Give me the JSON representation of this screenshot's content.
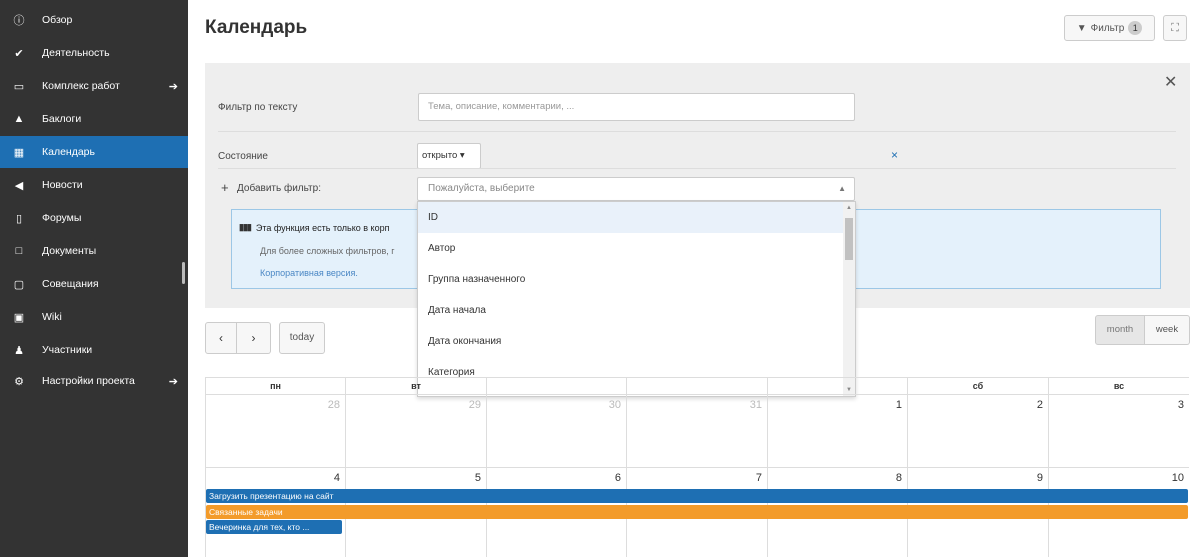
{
  "sidebar": {
    "items": [
      {
        "icon": "info-icon",
        "glyph": "ⓘ",
        "label": "Обзор"
      },
      {
        "icon": "check-icon",
        "glyph": "✔",
        "label": "Деятельность"
      },
      {
        "icon": "folder-icon",
        "glyph": "▭",
        "label": "Комплекс работ",
        "arrow": "➔"
      },
      {
        "icon": "warning-icon",
        "glyph": "▲",
        "label": "Баклоги"
      },
      {
        "icon": "calendar-icon",
        "glyph": "▦",
        "label": "Календарь"
      },
      {
        "icon": "megaphone-icon",
        "glyph": "◀",
        "label": "Новости"
      },
      {
        "icon": "forum-icon",
        "glyph": "▯",
        "label": "Форумы"
      },
      {
        "icon": "document-icon",
        "glyph": "□",
        "label": "Документы"
      },
      {
        "icon": "meeting-icon",
        "glyph": "▢",
        "label": "Совещания"
      },
      {
        "icon": "book-icon",
        "glyph": "▣",
        "label": "Wiki"
      },
      {
        "icon": "users-icon",
        "glyph": "♟",
        "label": "Участники"
      },
      {
        "icon": "settings-icon",
        "glyph": "⚙",
        "label": "Настройки проекта",
        "arrow": "➔"
      }
    ]
  },
  "header": {
    "title": "Календарь",
    "filter_label": "Фильтр",
    "filter_count": "1",
    "filter_icon": "filter-icon",
    "fullscreen_icon": "fullscreen-icon"
  },
  "filters": {
    "text_label": "Фильтр по тексту",
    "text_placeholder": "Тема, описание, комментарии, ...",
    "state_label": "Состояние",
    "state_value": "открыто ▾",
    "remove_glyph": "×",
    "close_glyph": "✕",
    "add_plus": "+",
    "add_label": "Добавить фильтр:",
    "add_placeholder": "Пожалуйста, выберите",
    "add_caret": "▲",
    "info_title": "Эта функция есть только в корп",
    "info_text": "Для более сложных фильтров, г",
    "info_link": "Корпоративная версия."
  },
  "dropdown": {
    "options": [
      "ID",
      "Автор",
      "Группа назначенного",
      "Дата начала",
      "Дата окончания",
      "Категория"
    ],
    "up_arrow": "▲",
    "down_arrow": "▼"
  },
  "toolbar": {
    "prev": "‹",
    "next": "›",
    "today": "today",
    "month": "month",
    "week": "week"
  },
  "calendar": {
    "weekdays": [
      "пн",
      "вт",
      "",
      "",
      "",
      "сб",
      "вс"
    ],
    "weeks": [
      [
        {
          "day": "28",
          "other": true
        },
        {
          "day": "29",
          "other": true
        },
        {
          "day": "30",
          "other": true
        },
        {
          "day": "31",
          "other": true
        },
        {
          "day": "1",
          "other": false
        },
        {
          "day": "2",
          "other": false
        },
        {
          "day": "3",
          "other": false
        }
      ],
      [
        {
          "day": "4",
          "other": false
        },
        {
          "day": "5",
          "other": false
        },
        {
          "day": "6",
          "other": false
        },
        {
          "day": "7",
          "other": false
        },
        {
          "day": "8",
          "other": false
        },
        {
          "day": "9",
          "other": false
        },
        {
          "day": "10",
          "other": false
        }
      ]
    ],
    "events": [
      {
        "title": "Загрузить презентацию на сайт",
        "color": "#1e6fb3"
      },
      {
        "title": "Связанные задачи",
        "color": "#f39b2a"
      },
      {
        "title": "Вечеринка для тех, кто ...",
        "color": "#1e6fb3"
      }
    ]
  },
  "colors": {
    "accent": "#1e6fb3",
    "sidebar_bg": "#333333",
    "event_orange": "#f39b2a"
  }
}
